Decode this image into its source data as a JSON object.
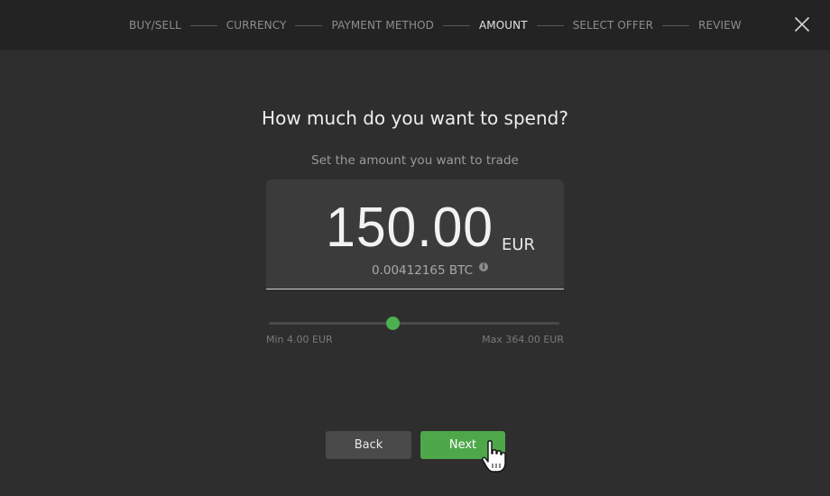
{
  "steps": [
    {
      "label": "BUY/SELL",
      "active": false
    },
    {
      "label": "CURRENCY",
      "active": false
    },
    {
      "label": "PAYMENT METHOD",
      "active": false
    },
    {
      "label": "AMOUNT",
      "active": true
    },
    {
      "label": "SELECT OFFER",
      "active": false
    },
    {
      "label": "REVIEW",
      "active": false
    }
  ],
  "close_icon": "close-icon",
  "title": "How much do you want to spend?",
  "subtitle": "Set the amount you want to trade",
  "amount": {
    "value": "150.00",
    "currency": "EUR",
    "converted": "0.00412165 BTC"
  },
  "slider": {
    "min_label": "Min 4.00 EUR",
    "max_label": "Max 364.00 EUR",
    "min": 4.0,
    "max": 364.0,
    "value": 150.0,
    "accent": "#4caf50"
  },
  "buttons": {
    "back": "Back",
    "next": "Next"
  },
  "colors": {
    "background": "#2e2e2e",
    "topbar": "#232323",
    "primary": "#4ea84a"
  }
}
